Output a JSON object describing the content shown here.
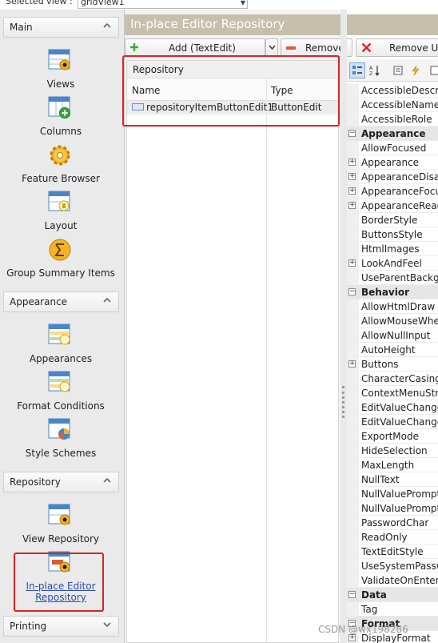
{
  "topbar": {
    "selected_view_label": "Selected view :",
    "selected_view_value": "gridView1"
  },
  "sidebar": {
    "groups": [
      {
        "title": "Main",
        "items": [
          {
            "label": "Views",
            "icon": "views-icon"
          },
          {
            "label": "Columns",
            "icon": "columns-icon"
          },
          {
            "label": "Feature Browser",
            "icon": "feature-browser-icon"
          },
          {
            "label": "Layout",
            "icon": "layout-icon"
          },
          {
            "label": "Group Summary Items",
            "icon": "group-summary-icon"
          }
        ]
      },
      {
        "title": "Appearance",
        "items": [
          {
            "label": "Appearances",
            "icon": "appearances-icon"
          },
          {
            "label": "Format Conditions",
            "icon": "format-conditions-icon"
          },
          {
            "label": "Style Schemes",
            "icon": "style-schemes-icon"
          }
        ]
      },
      {
        "title": "Repository",
        "items": [
          {
            "label": "View Repository",
            "icon": "view-repository-icon"
          },
          {
            "label_line1": "In-place Editor",
            "label_line2": "Repository",
            "icon": "inplace-editor-repository-icon",
            "selected": true
          }
        ]
      },
      {
        "title": "Printing",
        "items": []
      }
    ]
  },
  "main": {
    "title": "In-place Editor Repository",
    "toolbar": {
      "add_label": "Add (TextEdit)",
      "remove_label": "Remove",
      "remove_unused_label": "Remove Un"
    },
    "grid": {
      "group_header": "Repository",
      "columns": [
        "Name",
        "Type"
      ],
      "rows": [
        {
          "name": "repositoryItemButtonEdit1",
          "type": "ButtonEdit"
        }
      ]
    }
  },
  "properties": {
    "rows": [
      {
        "text": "AccessibleDescript",
        "kind": "prop"
      },
      {
        "text": "AccessibleName",
        "kind": "prop"
      },
      {
        "text": "AccessibleRole",
        "kind": "prop"
      },
      {
        "text": "Appearance",
        "kind": "cat"
      },
      {
        "text": "AllowFocused",
        "kind": "prop"
      },
      {
        "text": "Appearance",
        "kind": "exp"
      },
      {
        "text": "AppearanceDisabl",
        "kind": "exp"
      },
      {
        "text": "AppearanceFocuse",
        "kind": "exp"
      },
      {
        "text": "AppearanceReadO",
        "kind": "exp"
      },
      {
        "text": "BorderStyle",
        "kind": "prop"
      },
      {
        "text": "ButtonsStyle",
        "kind": "prop"
      },
      {
        "text": "HtmlImages",
        "kind": "prop"
      },
      {
        "text": "LookAndFeel",
        "kind": "exp"
      },
      {
        "text": "UseParentBackgro",
        "kind": "prop"
      },
      {
        "text": "Behavior",
        "kind": "cat"
      },
      {
        "text": "AllowHtmlDraw",
        "kind": "prop"
      },
      {
        "text": "AllowMouseWhee",
        "kind": "prop"
      },
      {
        "text": "AllowNullInput",
        "kind": "prop"
      },
      {
        "text": "AutoHeight",
        "kind": "prop"
      },
      {
        "text": "Buttons",
        "kind": "exp"
      },
      {
        "text": "CharacterCasing",
        "kind": "prop"
      },
      {
        "text": "ContextMenuStrip",
        "kind": "prop"
      },
      {
        "text": "EditValueChanged",
        "kind": "prop"
      },
      {
        "text": "EditValueChanged",
        "kind": "prop"
      },
      {
        "text": "ExportMode",
        "kind": "prop"
      },
      {
        "text": "HideSelection",
        "kind": "prop"
      },
      {
        "text": "MaxLength",
        "kind": "prop"
      },
      {
        "text": "NullText",
        "kind": "prop"
      },
      {
        "text": "NullValuePrompt",
        "kind": "prop"
      },
      {
        "text": "NullValuePromptS",
        "kind": "prop"
      },
      {
        "text": "PasswordChar",
        "kind": "prop"
      },
      {
        "text": "ReadOnly",
        "kind": "prop"
      },
      {
        "text": "TextEditStyle",
        "kind": "prop"
      },
      {
        "text": "UseSystemPasswo",
        "kind": "prop"
      },
      {
        "text": "ValidateOnEnterK",
        "kind": "prop"
      },
      {
        "text": "Data",
        "kind": "cat"
      },
      {
        "text": "Tag",
        "kind": "prop"
      },
      {
        "text": "Format",
        "kind": "cat"
      },
      {
        "text": "DisplayFormat",
        "kind": "exp"
      }
    ]
  },
  "watermark": "CSDN @wx198286",
  "colors": {
    "title_bar": "#c5bfac",
    "selection_outline": "#e02020",
    "remove_unused_icon": "#d42828",
    "remove_icon": "#e05a3a",
    "add_icon": "#3aa83a"
  }
}
